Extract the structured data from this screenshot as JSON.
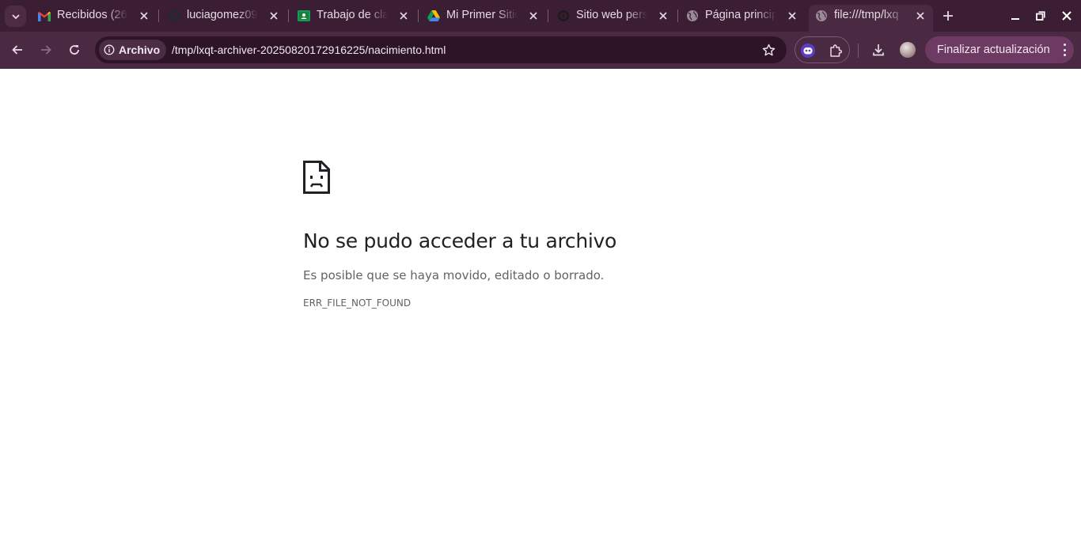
{
  "tabs": [
    {
      "title": "Recibidos (26",
      "icon": "gmail-icon"
    },
    {
      "title": "luciagomez09",
      "icon": "github-icon"
    },
    {
      "title": "Trabajo de cla",
      "icon": "classroom-icon"
    },
    {
      "title": "Mi Primer Sitio",
      "icon": "drive-icon"
    },
    {
      "title": "Sitio web pers",
      "icon": "openai-icon"
    },
    {
      "title": "Página princip",
      "icon": "globe-icon"
    },
    {
      "title": "file:///tmp/lxq",
      "icon": "globe-icon",
      "active": true
    }
  ],
  "toolbar": {
    "site_chip_label": "Archivo",
    "url": "/tmp/lxqt-archiver-20250820172916225/nacimiento.html",
    "update_button_label": "Finalizar actualización"
  },
  "error": {
    "title": "No se pudo acceder a tu archivo",
    "description": "Es posible que se haya movido, editado o borrado.",
    "code": "ERR_FILE_NOT_FOUND"
  },
  "colors": {
    "tabstrip_bg": "#3b1e33",
    "toolbar_bg": "#4a2a42",
    "omnibox_bg": "#2d1527",
    "update_button_bg": "#6d3a63"
  }
}
